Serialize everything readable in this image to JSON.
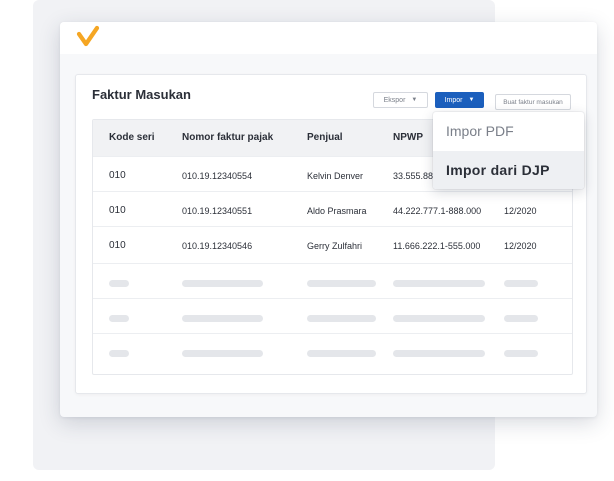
{
  "window": {
    "logo_icon": "checkmark-logo-icon",
    "accent_color": "#f5a623"
  },
  "card": {
    "title": "Faktur Masukan",
    "buttons": {
      "ekspor": "Ekspor",
      "impor": "Impor",
      "buat": "Buat faktur masukan"
    }
  },
  "table": {
    "headers": [
      "Kode seri",
      "Nomor faktur pajak",
      "Penjual",
      "NPWP"
    ],
    "rows": [
      {
        "kode": "010",
        "nomor": "010.19.12340554",
        "penjual": "Kelvin Denver",
        "npwp": "33.555.88",
        "masa": ""
      },
      {
        "kode": "010",
        "nomor": "010.19.12340551",
        "penjual": "Aldo Prasmara",
        "npwp": "44.222.777.1-888.000",
        "masa": "12/2020"
      },
      {
        "kode": "010",
        "nomor": "010.19.12340546",
        "penjual": "Gerry Zulfahri",
        "npwp": "11.666.222.1-555.000",
        "masa": "12/2020"
      }
    ],
    "placeholder_rows": 3
  },
  "dropdown": {
    "items": [
      "Impor PDF",
      "Impor dari DJP"
    ]
  },
  "colors": {
    "primary": "#1b5fbd",
    "placeholder": "#e4e6ea"
  }
}
